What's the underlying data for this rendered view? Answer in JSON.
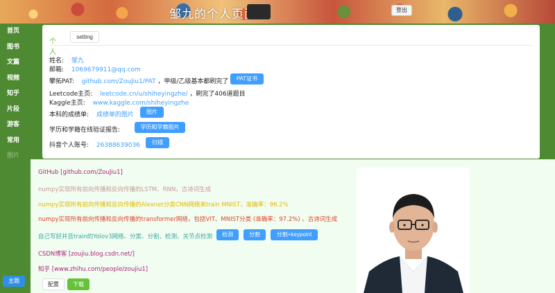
{
  "header": {
    "title": "邹九的个人页面",
    "logout_label": "登出"
  },
  "sidebar": {
    "items": [
      {
        "label": "首页"
      },
      {
        "label": "图书"
      },
      {
        "label": "文篇"
      },
      {
        "label": "视频"
      },
      {
        "label": "知乎"
      },
      {
        "label": "片段"
      },
      {
        "label": "游客"
      },
      {
        "label": "常用"
      },
      {
        "label": "图片",
        "disabled": true
      }
    ],
    "theme_label": "主题"
  },
  "tabs": {
    "active": "个人",
    "setting": "setting"
  },
  "profile": {
    "name_label": "姓名:",
    "name_value": "邹九",
    "email_label": "邮箱:",
    "email_value": "1069679911@qq.com",
    "pat_label": "攀拓PAT:",
    "pat_link": "github.com/ZouJiu1/PAT",
    "pat_text": "，甲级/乙级基本都刷完了",
    "pat_button": "PAT证书",
    "leetcode_label": "Leetcode主页:",
    "leetcode_link": "leetcode.cn/u/shiheyingzhe/",
    "leetcode_text": "，刷完了406道题目",
    "kaggle_label": "Kaggle主页:",
    "kaggle_link": "www.kaggle.com/shiheyingzhe",
    "transcript_label": "本科的成绩单:",
    "transcript_link": "成绩单的图片",
    "transcript_button": "图片",
    "degree_label": "学历和学籍在线验证报告:",
    "degree_button": "学历和学籍图片",
    "douyin_label": "抖音个人账号:",
    "douyin_value": "26388639036",
    "douyin_button": "扫描"
  },
  "projects": {
    "github": "GitHub [github.com/ZouJiu1]",
    "lstm": "numpy实现所有前向传播和反向传播的LSTM、RNN，古诗词生成",
    "alexnet": "numpy实现所有前向传播和反向传播的Alexnet分类CNN网络来train MNIST，准确率：96.2%",
    "transformer": "numpy实现所有前向传播和反向传播的transformer网络，包括VIT、MNIST分类 (准确率：97.2%) 、古诗词生成",
    "yolov3": "自己写好并且train的Yolov3网络、分类、分割、检测、关节点检测",
    "btn_detect": "检测",
    "btn_segment": "分割",
    "btn_segment_kp": "分割+keypoint",
    "csdn": "CSDN博客 [zoujiu.blog.csdn.net/]",
    "zhihu": "知乎 [www.zhihu.com/people/zoujiu1]",
    "config_button": "配置",
    "download_button": "下载"
  },
  "colors": {
    "sidebar_green": "#4e8a32",
    "link_blue": "#409eff",
    "accent_green": "#67c23a",
    "line_magenta": "#b0237a",
    "line_gray": "#c79a9a",
    "line_yellow": "#e6b800",
    "line_red": "#e0442a",
    "line_teal": "#3aa6a0"
  }
}
